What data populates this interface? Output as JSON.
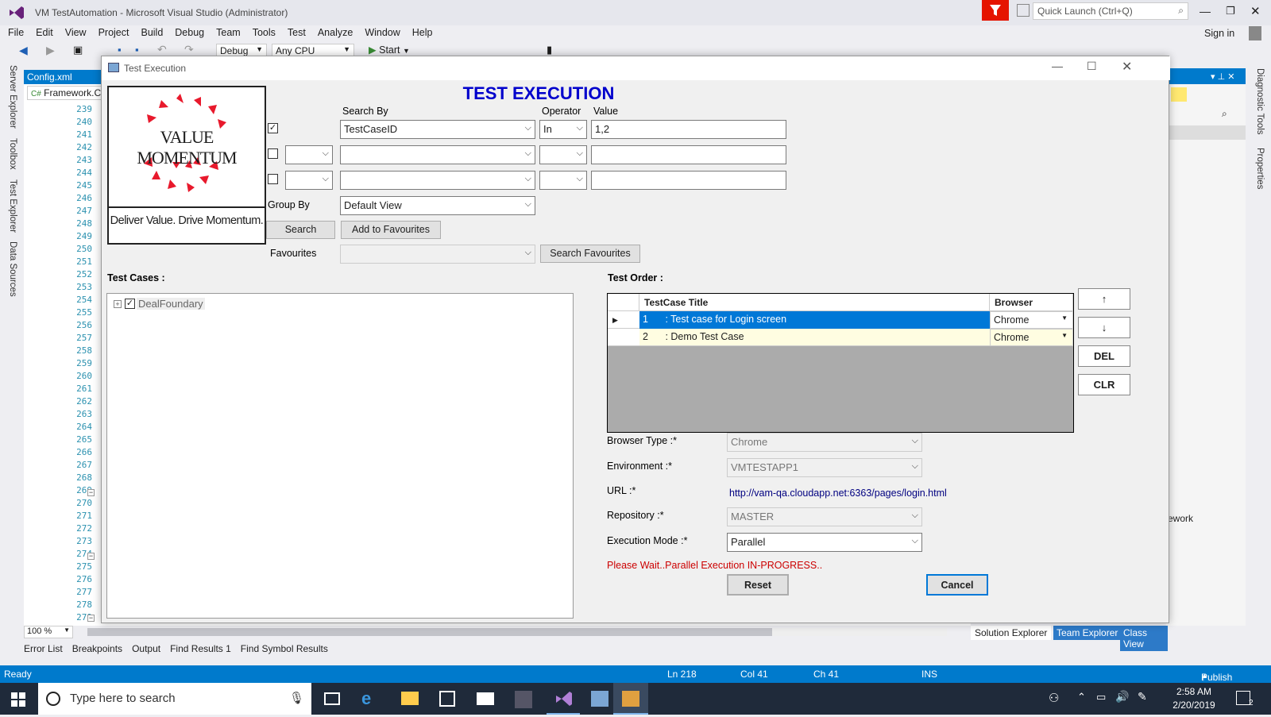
{
  "vs": {
    "title": "VM TestAutomation - Microsoft Visual Studio (Administrator)",
    "quick_launch_placeholder": "Quick Launch (Ctrl+Q)",
    "sign_in": "Sign in",
    "menu": [
      "File",
      "Edit",
      "View",
      "Project",
      "Build",
      "Debug",
      "Team",
      "Tools",
      "Test",
      "Analyze",
      "Window",
      "Help"
    ],
    "config": "Debug",
    "platform": "Any CPU",
    "start": "Start",
    "tab_config": "Config.xml",
    "tab_framework": "Framework.Co",
    "line_numbers": [
      "239",
      "240",
      "241",
      "242",
      "243",
      "244",
      "245",
      "246",
      "247",
      "248",
      "249",
      "250",
      "251",
      "252",
      "253",
      "254",
      "255",
      "256",
      "257",
      "258",
      "259",
      "260",
      "261",
      "262",
      "263",
      "264",
      "265",
      "266",
      "267",
      "268",
      "269",
      "270",
      "271",
      "272",
      "273",
      "274",
      "275",
      "276",
      "277",
      "278",
      "279"
    ],
    "zoom": "100 %",
    "left_tabs": [
      "Server Explorer",
      "Toolbox",
      "Test Explorer",
      "Data Sources"
    ],
    "right_tabs": [
      "Diagnostic Tools",
      "Properties"
    ],
    "right_panel_text": "ework",
    "bottom_tabs": [
      "Error List",
      "Breakpoints",
      "Output",
      "Find Results 1",
      "Find Symbol Results"
    ],
    "solution_tabs": [
      "Solution Explorer",
      "Team Explorer",
      "Class View"
    ],
    "status": {
      "ready": "Ready",
      "ln": "Ln 218",
      "col": "Col 41",
      "ch": "Ch 41",
      "ins": "INS",
      "publish": "Publish"
    }
  },
  "taskbar": {
    "search_placeholder": "Type here to search",
    "time": "2:58 AM",
    "date": "2/20/2019",
    "notif_count": "2"
  },
  "dialog": {
    "title": "Test Execution",
    "heading": "TEST EXECUTION",
    "logo_top": "VALUE MOMENTUM",
    "logo_tagline": "Deliver Value. Drive Momentum.",
    "search_by_label": "Search By",
    "operator_label": "Operator",
    "value_label": "Value",
    "row1": {
      "field": "TestCaseID",
      "operator": "In",
      "value": "1,2"
    },
    "group_by_label": "Group By",
    "group_by_value": "Default View",
    "search_btn": "Search",
    "add_fav_btn": "Add to Favourites",
    "favourites_label": "Favourites",
    "search_fav_btn": "Search Favourites",
    "test_cases_label": "Test Cases :",
    "tree_root": "DealFoundary",
    "test_order_label": "Test Order :",
    "grid_headers": {
      "title": "TestCase Title",
      "browser": "Browser"
    },
    "grid_rows": [
      {
        "num": "1",
        "title": ": Test case for Login screen",
        "browser": "Chrome"
      },
      {
        "num": "2",
        "title": ": Demo Test Case",
        "browser": "Chrome"
      }
    ],
    "order_buttons": {
      "up": "↑",
      "down": "↓",
      "del": "DEL",
      "clr": "CLR"
    },
    "browser_type_label": "Browser Type :*",
    "browser_type": "Chrome",
    "environment_label": "Environment :*",
    "environment": "VMTESTAPP1",
    "url_label": "URL :*",
    "url": "http://vam-qa.cloudapp.net:6363/pages/login.html",
    "repository_label": "Repository :*",
    "repository": "MASTER",
    "exec_mode_label": "Execution Mode :*",
    "exec_mode": "Parallel",
    "progress_msg": "Please Wait..Parallel Execution IN-PROGRESS..",
    "reset_btn": "Reset",
    "cancel_btn": "Cancel"
  },
  "colors": {
    "accent": "#007acc",
    "heading": "#0000cc",
    "selected": "#0078d7",
    "row_alt": "#fffde1",
    "error": "#cc0000"
  }
}
